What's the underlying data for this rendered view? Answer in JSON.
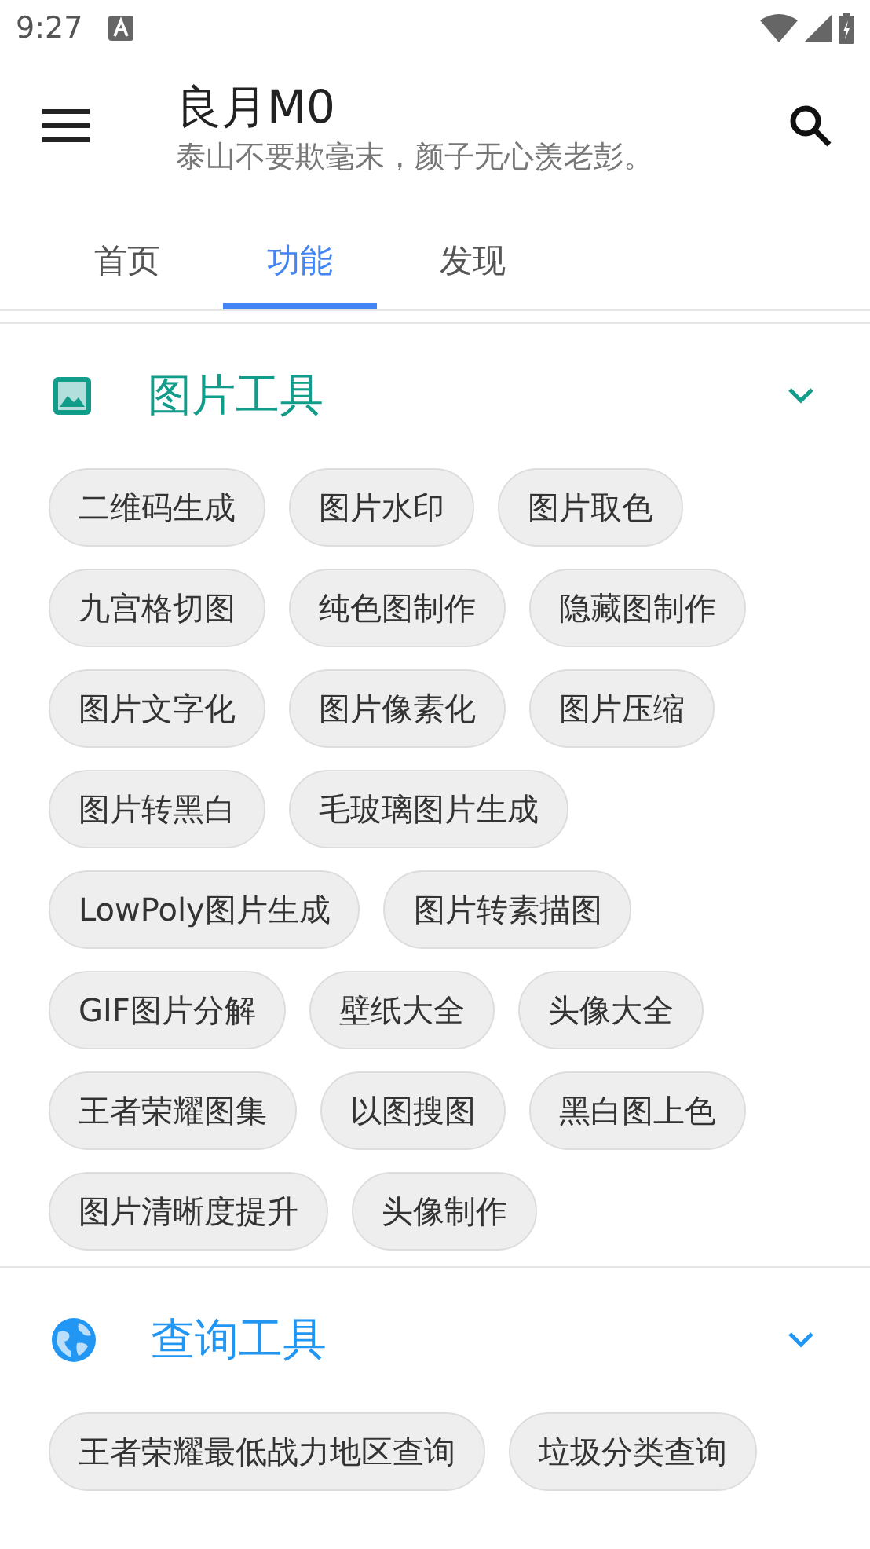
{
  "status_bar": {
    "time": "9:27"
  },
  "header": {
    "title": "良月M0",
    "subtitle": "泰山不要欺毫末，颜子无心羡老彭。"
  },
  "tabs": [
    {
      "label": "首页",
      "selected": false
    },
    {
      "label": "功能",
      "selected": true
    },
    {
      "label": "发现",
      "selected": false
    }
  ],
  "sections": [
    {
      "title": "图片工具",
      "kind": "picture",
      "color": "#129c8a",
      "expanded": true,
      "items": [
        "二维码生成",
        "图片水印",
        "图片取色",
        "九宫格切图",
        "纯色图制作",
        "隐藏图制作",
        "图片文字化",
        "图片像素化",
        "图片压缩",
        "图片转黑白",
        "毛玻璃图片生成",
        "LowPoly图片生成",
        "图片转素描图",
        "GIF图片分解",
        "壁纸大全",
        "头像大全",
        "王者荣耀图集",
        "以图搜图",
        "黑白图上色",
        "图片清晰度提升",
        "头像制作"
      ]
    },
    {
      "title": "查询工具",
      "kind": "globe",
      "color": "#2196f3",
      "expanded": true,
      "items": [
        "王者荣耀最低战力地区查询",
        "垃圾分类查询"
      ]
    }
  ]
}
